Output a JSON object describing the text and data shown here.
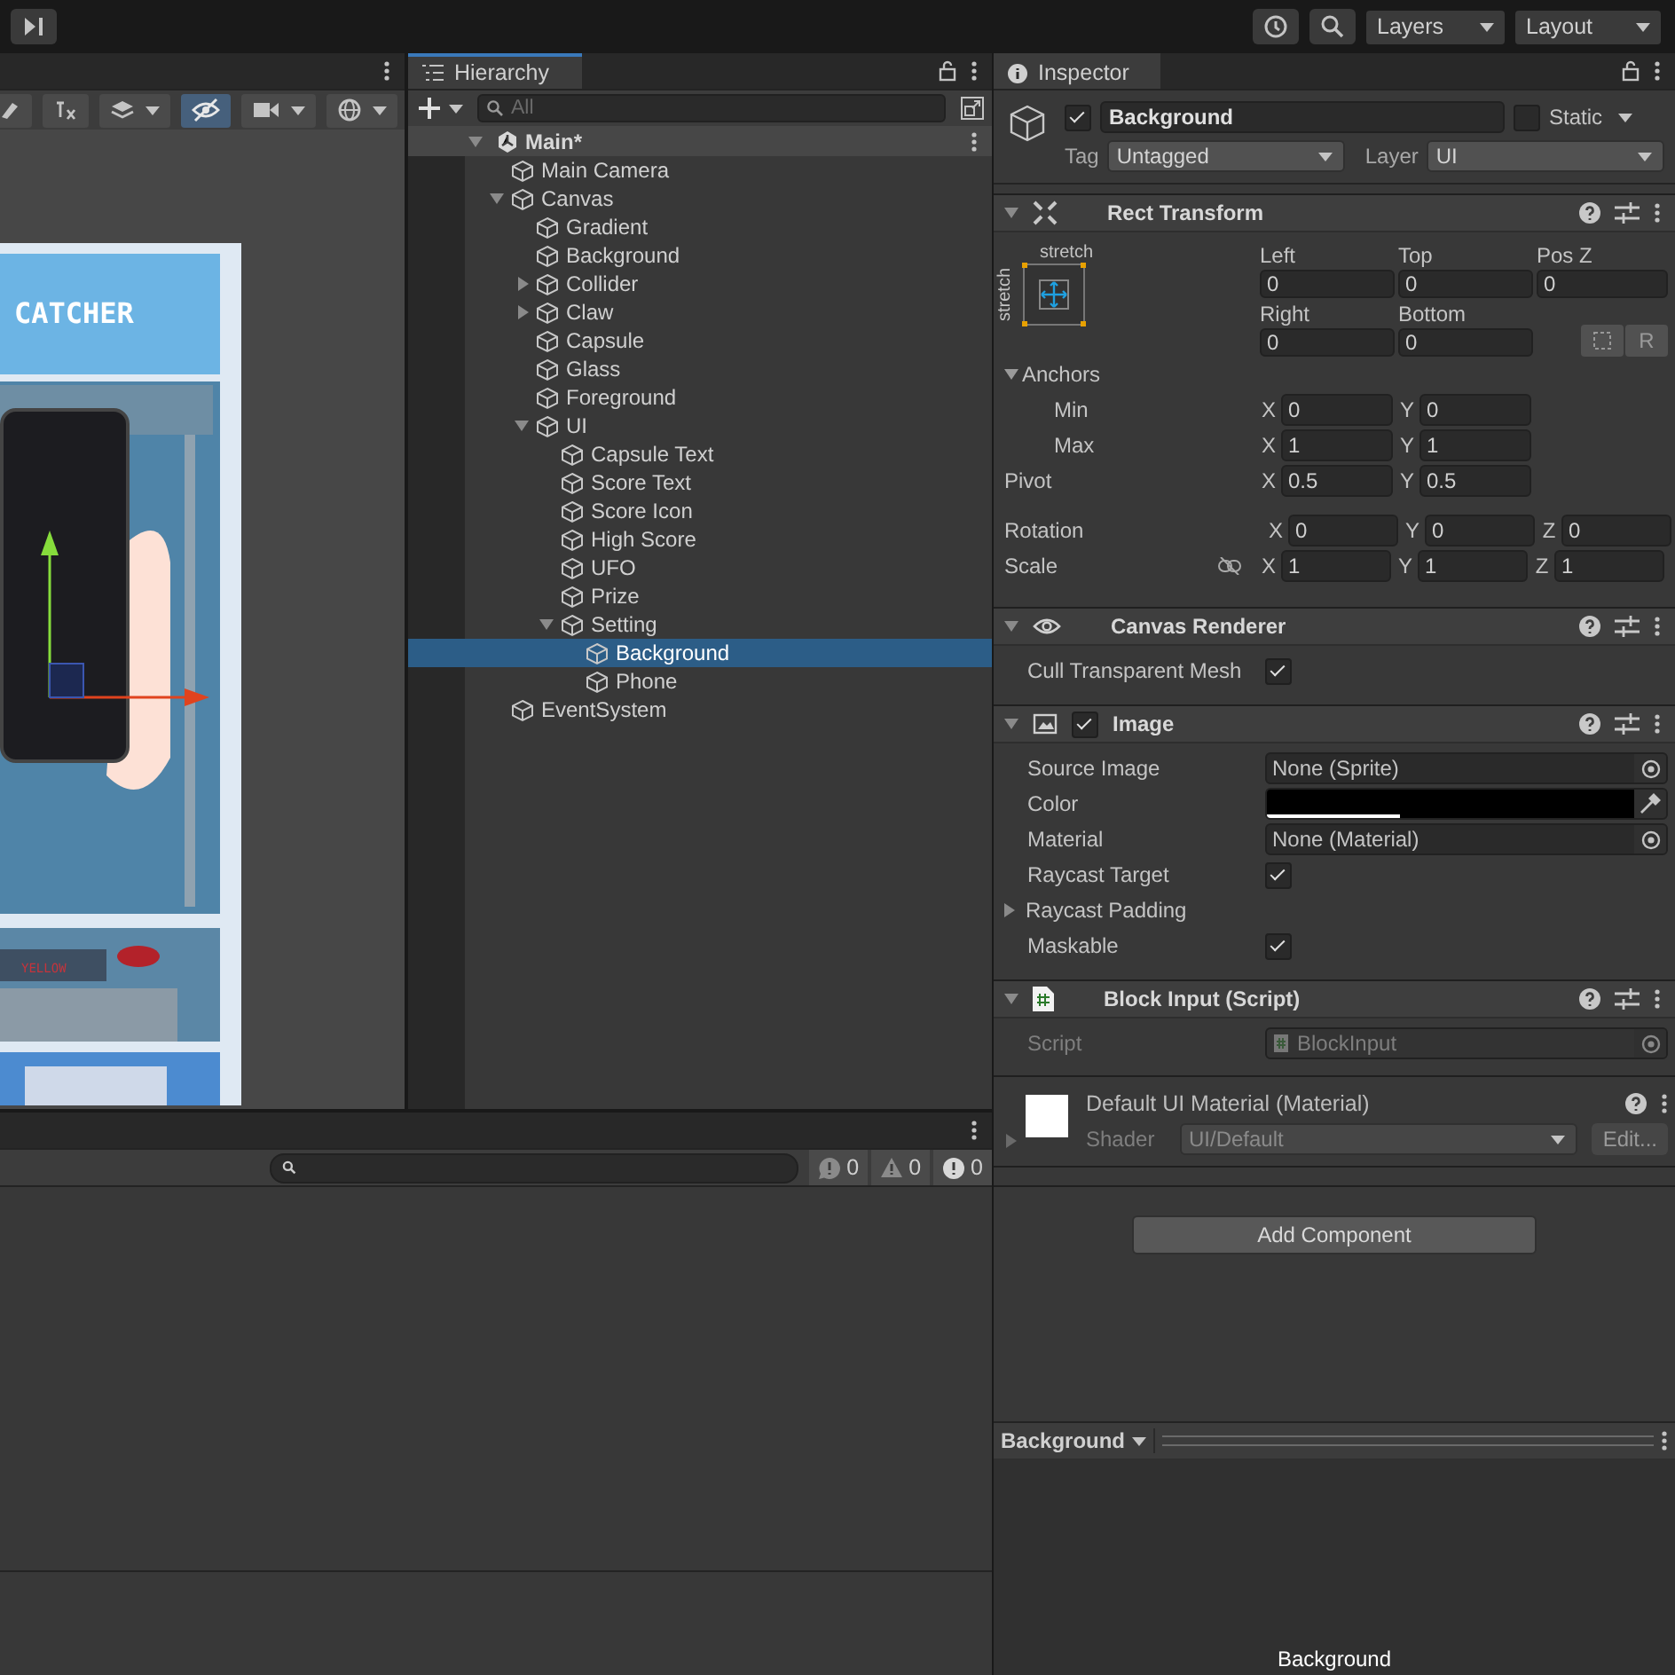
{
  "toolbar": {
    "layers": "Layers",
    "layout": "Layout"
  },
  "scene": {
    "tools": [
      {
        "kind": "brush",
        "selected": false,
        "menu": false
      },
      {
        "kind": "fx",
        "selected": false,
        "menu": false
      },
      {
        "kind": "layers",
        "selected": false,
        "menu": true
      },
      {
        "kind": "visibility",
        "selected": true,
        "menu": false
      },
      {
        "kind": "camera",
        "selected": false,
        "menu": true
      },
      {
        "kind": "gizmo",
        "selected": false,
        "menu": true
      }
    ],
    "game_title": "CATCHER",
    "game_display": "YELLOW"
  },
  "hierarchy": {
    "title": "Hierarchy",
    "placeholder": "All",
    "scene": "Main*",
    "items": [
      {
        "name": "Main Camera",
        "selected": false
      },
      {
        "name": "Canvas",
        "selected": false,
        "expanded": true,
        "children": [
          {
            "name": "Gradient",
            "selected": false
          },
          {
            "name": "Background",
            "selected": false
          },
          {
            "name": "Collider",
            "selected": false,
            "expanded": false
          },
          {
            "name": "Claw",
            "selected": false,
            "expanded": false
          },
          {
            "name": "Capsule",
            "selected": false
          },
          {
            "name": "Glass",
            "selected": false
          },
          {
            "name": "Foreground",
            "selected": false
          },
          {
            "name": "UI",
            "selected": false,
            "expanded": true,
            "children": [
              {
                "name": "Capsule Text",
                "selected": false
              },
              {
                "name": "Score Text",
                "selected": false
              },
              {
                "name": "Score Icon",
                "selected": false
              },
              {
                "name": "High Score",
                "selected": false
              },
              {
                "name": "UFO",
                "selected": false
              },
              {
                "name": "Prize",
                "selected": false
              },
              {
                "name": "Setting",
                "selected": false,
                "expanded": true,
                "children": [
                  {
                    "name": "Background",
                    "selected": true
                  },
                  {
                    "name": "Phone",
                    "selected": false
                  }
                ]
              }
            ]
          }
        ]
      },
      {
        "name": "EventSystem",
        "selected": false
      }
    ]
  },
  "inspector": {
    "title": "Inspector",
    "object": {
      "active": true,
      "name": "Background",
      "static": false,
      "static_label": "Static",
      "tag_label": "Tag",
      "tag": "Untagged",
      "layer_label": "Layer",
      "layer": "UI"
    },
    "rect": {
      "title": "Rect Transform",
      "expanded": true,
      "preset_h": "stretch",
      "preset_v": "stretch",
      "fields": [
        {
          "label": "Left",
          "value": "0"
        },
        {
          "label": "Top",
          "value": "0"
        },
        {
          "label": "Pos Z",
          "value": "0"
        },
        {
          "label": "Right",
          "value": "0"
        },
        {
          "label": "Bottom",
          "value": "0"
        }
      ],
      "raw_button": "R",
      "anchors": {
        "label": "Anchors",
        "expanded": true,
        "rows": [
          {
            "label": "Min",
            "values": [
              {
                "axis": "X",
                "value": "0"
              },
              {
                "axis": "Y",
                "value": "0"
              }
            ]
          },
          {
            "label": "Max",
            "values": [
              {
                "axis": "X",
                "value": "1"
              },
              {
                "axis": "Y",
                "value": "1"
              }
            ]
          }
        ]
      },
      "pivot": {
        "label": "Pivot",
        "values": [
          {
            "axis": "X",
            "value": "0.5"
          },
          {
            "axis": "Y",
            "value": "0.5"
          }
        ]
      },
      "rotation": {
        "label": "Rotation",
        "values": [
          {
            "axis": "X",
            "value": "0"
          },
          {
            "axis": "Y",
            "value": "0"
          },
          {
            "axis": "Z",
            "value": "0"
          }
        ]
      },
      "scale": {
        "label": "Scale",
        "values": [
          {
            "axis": "X",
            "value": "1"
          },
          {
            "axis": "Y",
            "value": "1"
          },
          {
            "axis": "Z",
            "value": "1"
          }
        ]
      }
    },
    "components": [
      {
        "kind": "canvas_renderer",
        "title": "Canvas Renderer",
        "expanded": true,
        "props": [
          {
            "kind": "toggle",
            "label": "Cull Transparent Mesh",
            "checked": true
          }
        ]
      },
      {
        "kind": "image",
        "title": "Image",
        "enabled": true,
        "expanded": true,
        "props": [
          {
            "kind": "object",
            "label": "Source Image",
            "value": "None (Sprite)"
          },
          {
            "kind": "color",
            "label": "Color",
            "color": "#000000",
            "level": 0.36
          },
          {
            "kind": "object",
            "label": "Material",
            "value": "None (Material)"
          },
          {
            "kind": "toggle",
            "label": "Raycast Target",
            "checked": true
          },
          {
            "kind": "foldout",
            "label": "Raycast Padding",
            "expanded": false
          },
          {
            "kind": "toggle",
            "label": "Maskable",
            "checked": true
          }
        ]
      },
      {
        "kind": "script",
        "title": "Block Input (Script)",
        "expanded": true,
        "props": [
          {
            "kind": "script",
            "label": "Script",
            "value": "BlockInput"
          }
        ]
      }
    ],
    "material": {
      "title": "Default UI Material (Material)",
      "shader_label": "Shader",
      "shader": "UI/Default",
      "edit": "Edit..."
    },
    "add_component": "Add Component",
    "preview": {
      "title": "Background",
      "caption": "Background"
    }
  },
  "console": {
    "counts": [
      {
        "kind": "info",
        "value": "0"
      },
      {
        "kind": "warning",
        "value": "0"
      },
      {
        "kind": "error",
        "value": "0"
      }
    ]
  }
}
